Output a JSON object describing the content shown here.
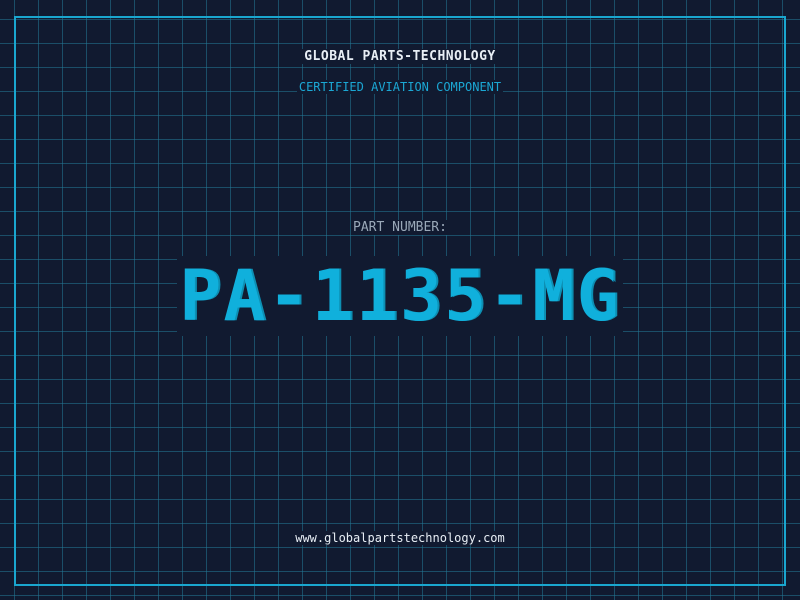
{
  "card": {
    "company_name": "GLOBAL PARTS-TECHNOLOGY",
    "tagline": "CERTIFIED AVIATION COMPONENT",
    "part_label": "PART NUMBER:",
    "part_number": "PA-1135-MG",
    "website": "www.globalpartstechnology.com"
  },
  "colors": {
    "background": "#111a30",
    "grid": "#23789a",
    "frame": "#1aa6cf",
    "accent": "#10b0dc",
    "text_primary": "#e8eef5",
    "text_muted": "#9aa8b8"
  }
}
